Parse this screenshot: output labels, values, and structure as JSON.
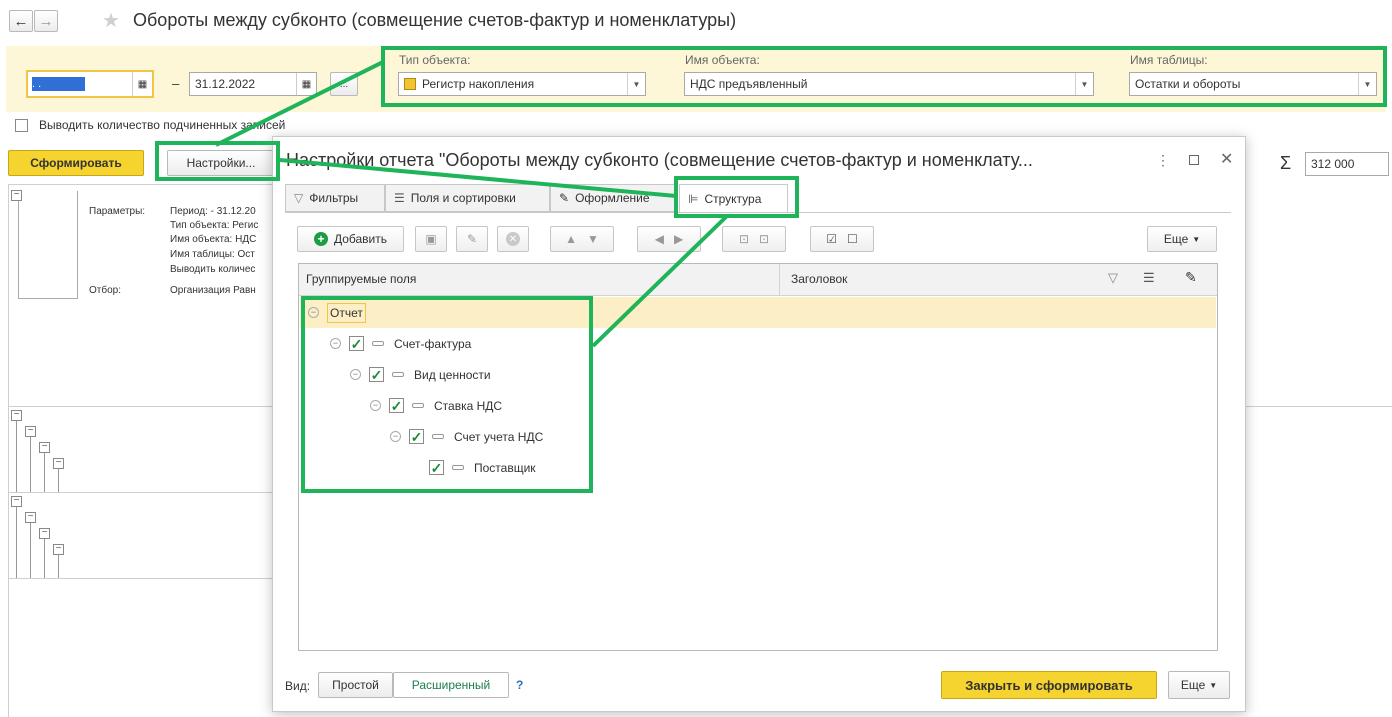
{
  "window": {
    "title": "Обороты между субконто (совмещение счетов-фактур и номенклатуры)"
  },
  "period": {
    "start": "  .  .",
    "separator": "–",
    "end": "31.12.2022",
    "more": "..."
  },
  "object_type": {
    "label": "Тип объекта:",
    "value": "Регистр накопления"
  },
  "object_name": {
    "label": "Имя объекта:",
    "value": "НДС предъявленный"
  },
  "table_name": {
    "label": "Имя таблицы:",
    "value": "Остатки и обороты"
  },
  "show_count_label": "Выводить количество подчиненных записей",
  "generate_button": "Сформировать",
  "settings_button": "Настройки...",
  "sum": {
    "symbol": "Σ",
    "value": "312 000"
  },
  "report_params": {
    "params_label": "Параметры:",
    "lines": [
      "Период:  - 31.12.20",
      "Тип объекта: Регис",
      "Имя объекта: НДС",
      "Имя таблицы: Ост",
      "Выводить количес"
    ],
    "filter_label": "Отбор:",
    "filter_value": "Организация Равн"
  },
  "dialog": {
    "title": "Настройки отчета \"Обороты между субконто (совмещение счетов-фактур и номенклату...",
    "tabs": [
      "Фильтры",
      "Поля и сортировки",
      "Оформление",
      "Структура"
    ],
    "add_button": "Добавить",
    "more_button": "Еще",
    "columns": {
      "grouped_fields": "Группируемые поля",
      "header": "Заголовок"
    },
    "tree": [
      {
        "label": "Отчет",
        "level": 0,
        "checkbox": false
      },
      {
        "label": "Счет-фактура",
        "level": 1,
        "checkbox": true
      },
      {
        "label": "Вид ценности",
        "level": 2,
        "checkbox": true
      },
      {
        "label": "Ставка НДС",
        "level": 3,
        "checkbox": true
      },
      {
        "label": "Счет учета НДС",
        "level": 4,
        "checkbox": true
      },
      {
        "label": "Поставщик",
        "level": 5,
        "checkbox": true
      }
    ],
    "view_label": "Вид:",
    "view_simple": "Простой",
    "view_extended": "Расширенный",
    "help": "?",
    "close_generate": "Закрыть и сформировать",
    "footer_more": "Еще"
  },
  "colors": {
    "accent_yellow": "#f5d42f",
    "highlight_green": "#1fb35a",
    "selected_row": "#fcefc5"
  }
}
